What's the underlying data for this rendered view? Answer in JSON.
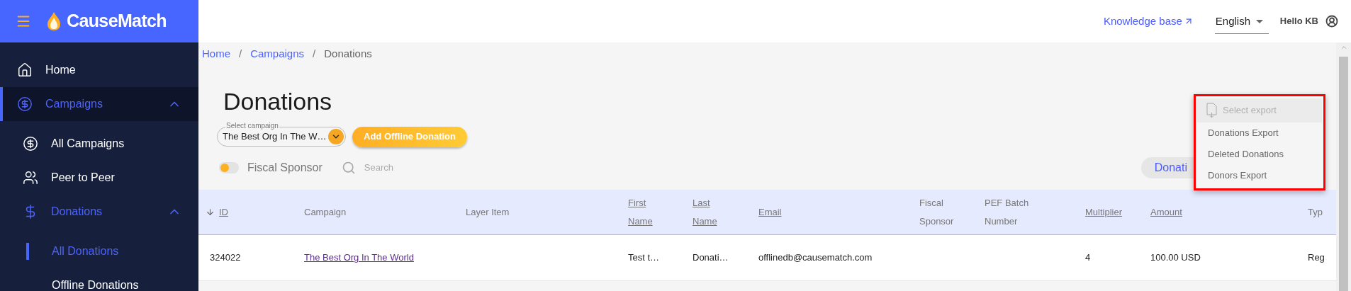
{
  "app": {
    "name": "CauseMatch"
  },
  "header": {
    "links": [
      {
        "label": "Knowledge base"
      }
    ],
    "language": {
      "value": "English"
    },
    "greeting": "Hello KB"
  },
  "sidebar": {
    "items": [
      {
        "label": "Home",
        "selected": false,
        "expanded": false
      },
      {
        "label": "Campaigns",
        "selected": true,
        "expanded": true,
        "children": [
          {
            "label": "All Campaigns",
            "selected": false,
            "expanded": false
          },
          {
            "label": "Peer to Peer",
            "selected": false,
            "expanded": false
          },
          {
            "label": "Donations",
            "selected": false,
            "expanded": true,
            "children": [
              {
                "label": "All Donations",
                "selected": true
              },
              {
                "label": "Offline Donations",
                "selected": false
              }
            ]
          }
        ]
      }
    ]
  },
  "breadcrumb": [
    {
      "kind": "link",
      "label": "Home"
    },
    {
      "kind": "separator",
      "label": "/"
    },
    {
      "kind": "link",
      "label": "Campaigns"
    },
    {
      "kind": "separator",
      "label": "/"
    },
    {
      "kind": "current",
      "label": "Donations"
    }
  ],
  "page": {
    "title": "Donations",
    "campaign_select": {
      "label": "Select campaign",
      "value": "The Best Org In The W…"
    },
    "add_button": "Add Offline Donation",
    "fiscal_sponsor_toggle": {
      "label": "Fiscal Sponsor",
      "on": false
    },
    "search": {
      "placeholder": "Search"
    },
    "chip": "Donati"
  },
  "export_menu": {
    "items": [
      {
        "label": "Select export",
        "disabled": true
      },
      {
        "label": "Donations Export",
        "disabled": false
      },
      {
        "label": "Deleted Donations",
        "disabled": false
      },
      {
        "label": "Donors Export",
        "disabled": false
      }
    ]
  },
  "table": {
    "columns": [
      {
        "label": "ID",
        "sortable": true,
        "sorted": true
      },
      {
        "label": "Campaign",
        "sortable": false,
        "sorted": false
      },
      {
        "label": "Layer Item",
        "sortable": false,
        "sorted": false
      },
      {
        "label": "First Name",
        "sortable": true,
        "sorted": false
      },
      {
        "label": "Last Name",
        "sortable": true,
        "sorted": false
      },
      {
        "label": "Email",
        "sortable": true,
        "sorted": false
      },
      {
        "label": "Fiscal Sponsor",
        "sortable": false,
        "sorted": false
      },
      {
        "label": "PEF Batch Number",
        "sortable": false,
        "sorted": false
      },
      {
        "label": "Multiplier",
        "sortable": true,
        "sorted": false
      },
      {
        "label": "Amount",
        "sortable": true,
        "sorted": false
      },
      {
        "label": "Typ",
        "sortable": false,
        "sorted": false
      }
    ],
    "rows": [
      {
        "cells": [
          {
            "text": "324022"
          },
          {
            "text": "The Best Org In The World",
            "kind": "link"
          },
          null,
          {
            "text": "Test t…"
          },
          {
            "text": "Donati…"
          },
          {
            "text": "offlinedb@causematch.com"
          },
          null,
          null,
          {
            "text": "4"
          },
          {
            "text": "100.00 USD"
          },
          {
            "text": "Reg"
          }
        ]
      }
    ]
  }
}
